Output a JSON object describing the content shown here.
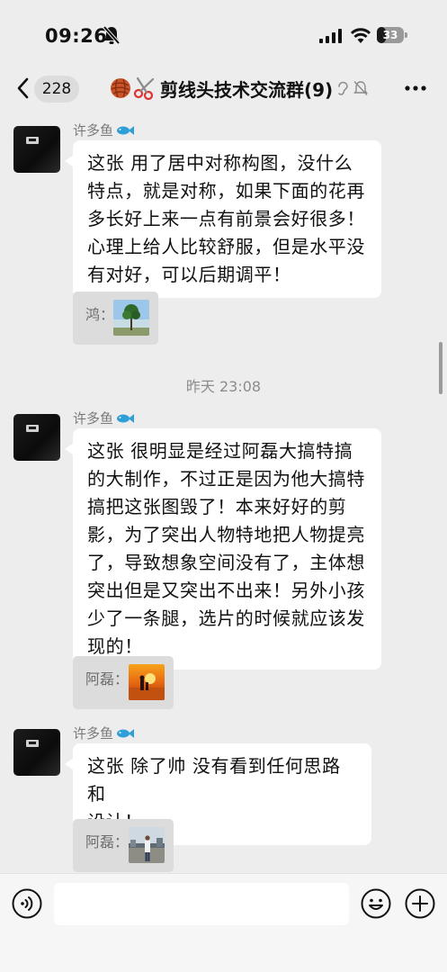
{
  "status_bar": {
    "time": "09:26",
    "battery": "33",
    "battery_level": 0.33,
    "icons": [
      "bell-off-icon",
      "signal-icon",
      "wifi-icon",
      "battery-icon"
    ]
  },
  "nav": {
    "unread_count": "228",
    "title": "剪线头技术交流群(9)",
    "icons": [
      "chevron-left-icon",
      "yarn-ball-icon",
      "scissors-icon",
      "ear-icon",
      "bell-off-icon",
      "more-icon"
    ]
  },
  "messages": [
    {
      "sender": "许多鱼",
      "lines": [
        "这张 用了居中对称构图，没什么",
        "特点，就是对称，如果下面的花再",
        "多长好上来一点有前景会好很多！",
        "心理上给人比较舒服，但是水平没",
        "有对好，可以后期调平！"
      ],
      "quote_name": "鸿：",
      "quote_thumb": "tree-photo"
    },
    {
      "sender": "许多鱼",
      "lines": [
        "这张 很明显是经过阿磊大搞特搞",
        "的大制作，不过正是因为他大搞特",
        "搞把这张图毁了！本来好好的剪",
        "影，为了突出人物特地把人物提亮",
        "了，导致想象空间没有了，主体想",
        "突出但是又突出不出来！另外小孩",
        "少了一条腿，选片的时候就应该发",
        "现的！"
      ],
      "quote_name": "阿磊：",
      "quote_thumb": "sunset-silhouette-photo"
    },
    {
      "sender": "许多鱼",
      "lines": [
        "这张 除了帅 没有看到任何思路和",
        "设计！"
      ],
      "quote_name": "阿磊：",
      "quote_thumb": "man-on-street-photo"
    }
  ],
  "timestamp": "昨天 23:08",
  "input_bar": {
    "placeholder": "",
    "icons": [
      "voice-icon",
      "emoji-icon",
      "plus-icon"
    ]
  },
  "colors": {
    "background": "#ededed",
    "bubble": "#ffffff",
    "quote": "#dcdcdc",
    "secondary_text": "#7a7a7a"
  }
}
